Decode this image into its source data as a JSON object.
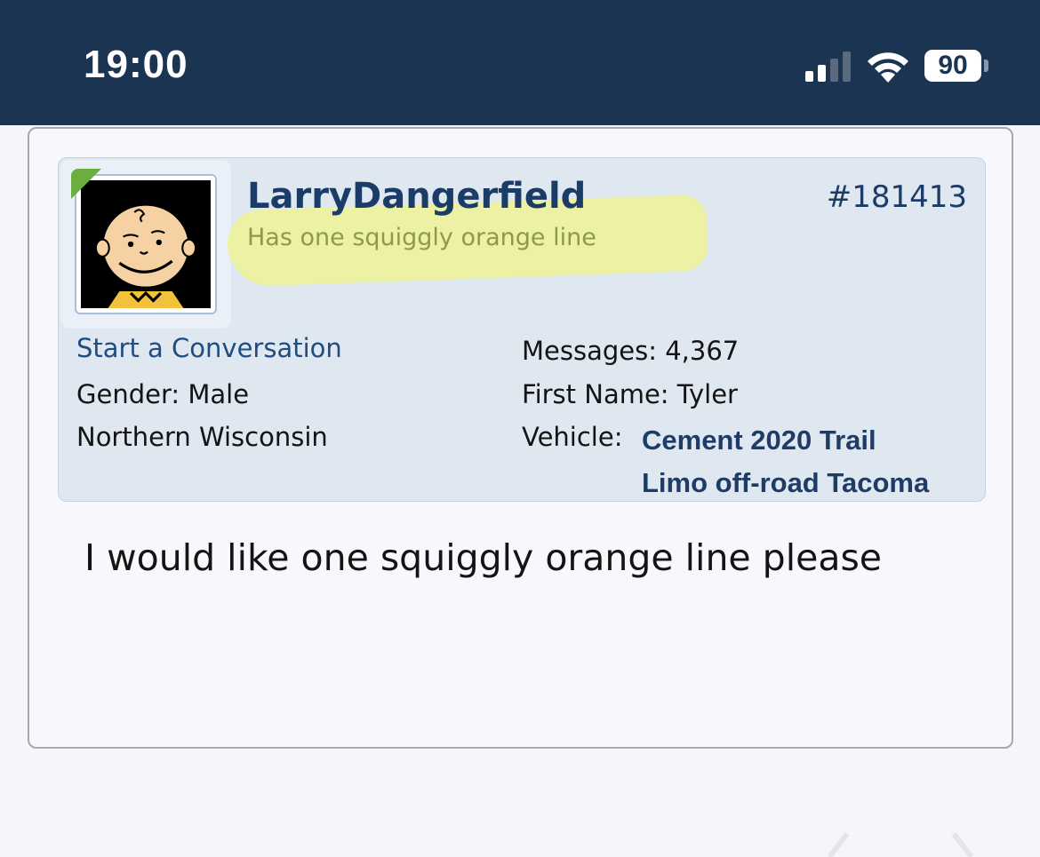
{
  "status_bar": {
    "time": "19:00",
    "battery": "90",
    "icons": [
      "signal-icon",
      "wifi-icon",
      "battery-icon"
    ]
  },
  "post": {
    "username": "LarryDangerfield",
    "user_title": "Has one squiggly orange line",
    "post_number": "#181413",
    "start_conversation": "Start a Conversation",
    "gender_label": "Gender:",
    "gender_value": "Male",
    "location": "Northern Wisconsin",
    "messages_label": "Messages:",
    "messages_value": "4,367",
    "first_name_label": "First Name:",
    "first_name_value": "Tyler",
    "vehicle_label": "Vehicle:",
    "vehicle_line1": "Cement 2020 Trail",
    "vehicle_line2": "Limo off-road Tacoma",
    "message_text": "I would like one squiggly orange line please"
  },
  "colors": {
    "status_bar_bg": "#1b3452",
    "user_block_bg": "#dfe7f1",
    "username": "#1b3c66",
    "highlight": "#eef296",
    "online": "#6aae3f"
  }
}
